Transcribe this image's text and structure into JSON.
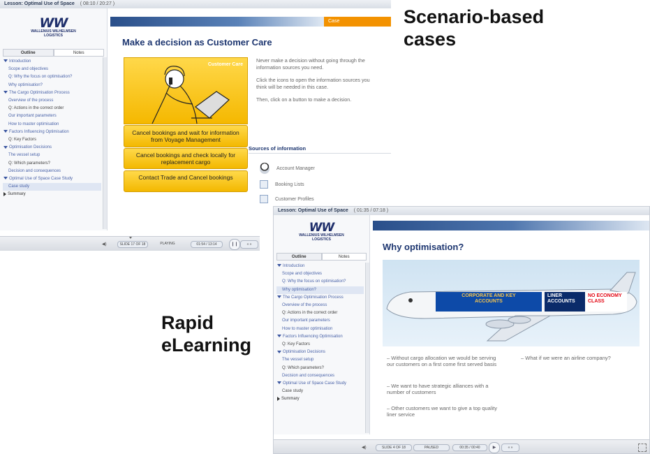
{
  "captions": {
    "top_right": "Scenario-based cases",
    "middle_left": "Rapid eLearning"
  },
  "colors": {
    "accent_orange": "#f39200",
    "brand_blue": "#1d3670",
    "decision_yellow": "#ffcc00",
    "no_economy_red": "#e30613"
  },
  "player1": {
    "title": "Lesson: Optimal Use of Space",
    "time": "( 08:10 / 20:27 )",
    "logo_mark": "WW",
    "logo_name_1": "WALLENIUS WILHELMSEN",
    "logo_name_2": "LOGISTICS",
    "tabs": [
      "Outline",
      "Notes"
    ],
    "outline": [
      {
        "label": "Introduction",
        "kind": "sec"
      },
      {
        "label": "Scope and objectives",
        "kind": "item"
      },
      {
        "label": "Q: Why the focus on optimisation?",
        "kind": "item"
      },
      {
        "label": "Why optimisation?",
        "kind": "item"
      },
      {
        "label": "The Cargo Optimisation Process",
        "kind": "sec"
      },
      {
        "label": "Overview of the process",
        "kind": "item"
      },
      {
        "label": "Q: Actions in the correct order",
        "kind": "q"
      },
      {
        "label": "Our important parameters",
        "kind": "item"
      },
      {
        "label": "How to master optimisation",
        "kind": "item"
      },
      {
        "label": "Factors Influencing Optimisation",
        "kind": "sec"
      },
      {
        "label": "Q: Key Factors",
        "kind": "q"
      },
      {
        "label": "Optimisation Decisions",
        "kind": "sec"
      },
      {
        "label": "The vessel setup",
        "kind": "item"
      },
      {
        "label": "Q: Which parameters?",
        "kind": "q"
      },
      {
        "label": "Decision and consequences",
        "kind": "item"
      },
      {
        "label": "Optimal Use of Space Case Study",
        "kind": "sec"
      },
      {
        "label": "Case study",
        "kind": "sel"
      },
      {
        "label": "Summary",
        "kind": "sum"
      }
    ],
    "case_tag": "Case",
    "slide_title": "Make a decision as Customer Care",
    "image_label": "Customer Care",
    "instructions": [
      "Never make a decision without going through the information sources you need.",
      "Click the icons to open the information sources you think will be needed in this case.",
      "Then, click on a button to make a decision."
    ],
    "decisions": [
      "Cancel bookings and wait for information from Voyage Management",
      "Cancel bookings and check locally for replacement cargo",
      "Contact Trade and Cancel bookings"
    ],
    "sources_heading": "Sources of information",
    "sources": [
      "Account Manager",
      "Booking Lists",
      "Customer Profiles"
    ],
    "controls": {
      "slide": "SLIDE 17 OF 18",
      "status": "PLAYING",
      "time": "01:54 / 13:14"
    }
  },
  "player2": {
    "title": "Lesson: Optimal Use of Space",
    "time": "( 01:35 / 07:18 )",
    "logo_mark": "WW",
    "logo_name_1": "WALLENIUS WILHELMSEN",
    "logo_name_2": "LOGISTICS",
    "tabs": [
      "Outline",
      "Notes"
    ],
    "outline": [
      {
        "label": "Introduction",
        "kind": "sec"
      },
      {
        "label": "Scope and objectives",
        "kind": "item"
      },
      {
        "label": "Q: Why the focus on optimisation?",
        "kind": "item"
      },
      {
        "label": "Why optimisation?",
        "kind": "sel"
      },
      {
        "label": "The Cargo Optimisation Process",
        "kind": "sec"
      },
      {
        "label": "Overview of the process",
        "kind": "item"
      },
      {
        "label": "Q: Actions in the correct order",
        "kind": "q"
      },
      {
        "label": "Our important parameters",
        "kind": "item"
      },
      {
        "label": "How to master optimisation",
        "kind": "item"
      },
      {
        "label": "Factors Influencing Optimisation",
        "kind": "sec"
      },
      {
        "label": "Q: Key Factors",
        "kind": "q"
      },
      {
        "label": "Optimisation Decisions",
        "kind": "sec"
      },
      {
        "label": "The vessel setup",
        "kind": "item"
      },
      {
        "label": "Q: Which parameters?",
        "kind": "q"
      },
      {
        "label": "Decision and consequences",
        "kind": "item"
      },
      {
        "label": "Optimal Use of Space Case Study",
        "kind": "sec"
      },
      {
        "label": "Case study",
        "kind": "q"
      },
      {
        "label": "Summary",
        "kind": "sum"
      }
    ],
    "slide_title": "Why optimisation?",
    "plane_labels": {
      "corporate": "CORPORATE AND KEY ACCOUNTS",
      "liner": "LINER ACCOUNTS",
      "no_economy": "NO ECONOMY CLASS"
    },
    "bullets_left": [
      "Without cargo allocation we would be serving our customers on a first come first served basis",
      "We want to have strategic alliances with a number of customers",
      "Other customers we want to give a top quality liner service"
    ],
    "bullets_right": [
      "What if we were an airline company?"
    ],
    "controls": {
      "slide": "SLIDE 4 OF 18",
      "status": "PAUSED",
      "time": "00:35 / 00:40"
    }
  }
}
